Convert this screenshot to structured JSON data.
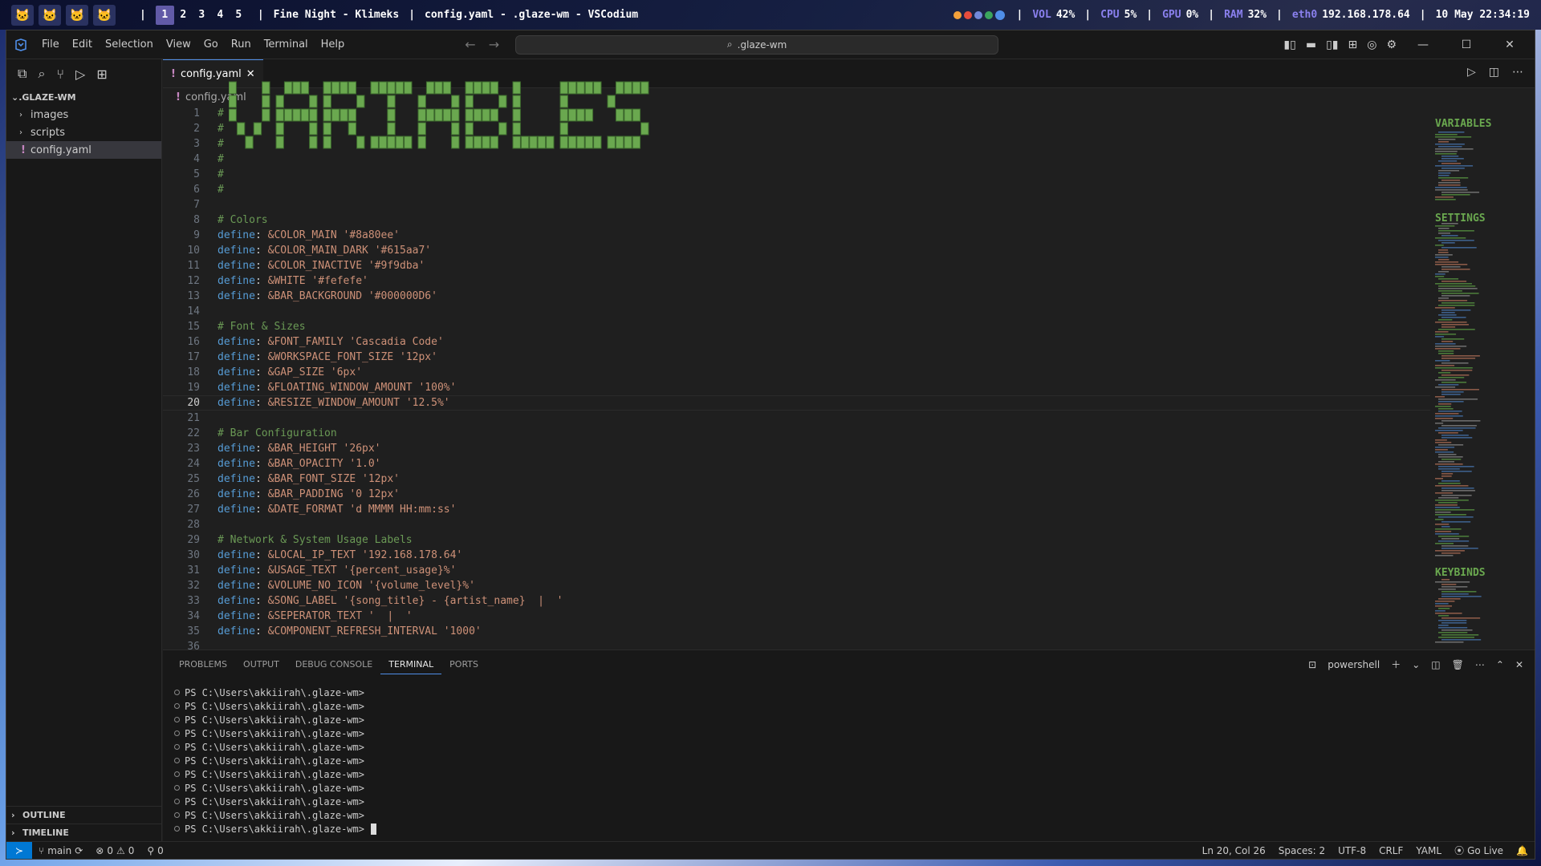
{
  "topbar": {
    "avatars": [
      "🐱",
      "🐱",
      "🐱",
      "🐱"
    ],
    "workspaces": [
      "1",
      "2",
      "3",
      "4",
      "5"
    ],
    "active_workspace": "1",
    "song": "Fine Night - Klimeks",
    "window_title": "config.yaml - .glaze-wm - VSCodium",
    "vol_label": "VOL",
    "vol_value": "42%",
    "cpu_label": "CPU",
    "cpu_value": "5%",
    "gpu_label": "GPU",
    "gpu_value": "0%",
    "ram_label": "RAM",
    "ram_value": "32%",
    "net_label": "eth0",
    "net_value": "192.168.178.64",
    "datetime": "10 May 22:34:19",
    "separator": "|"
  },
  "titlebar": {
    "menu": [
      "File",
      "Edit",
      "Selection",
      "View",
      "Go",
      "Run",
      "Terminal",
      "Help"
    ],
    "search_text": ".glaze-wm"
  },
  "sidebar": {
    "explorer_title": ".GLAZE-WM",
    "folders": [
      "images",
      "scripts"
    ],
    "file": "config.yaml",
    "outline": "OUTLINE",
    "timeline": "TIMELINE"
  },
  "editor": {
    "tab_label": "config.yaml",
    "breadcrumb": "config.yaml",
    "current_line": 20,
    "lines": [
      {
        "n": "1",
        "t": "# "
      },
      {
        "n": "2",
        "t": "# "
      },
      {
        "n": "3",
        "t": "# "
      },
      {
        "n": "4",
        "t": "# "
      },
      {
        "n": "5",
        "t": "# "
      },
      {
        "n": "6",
        "t": "# "
      },
      {
        "n": "7",
        "t": ""
      },
      {
        "n": "8",
        "t": "# Colors"
      },
      {
        "n": "9",
        "k": "define",
        "a": "&COLOR_MAIN",
        "s": "'#8a80ee'"
      },
      {
        "n": "10",
        "k": "define",
        "a": "&COLOR_MAIN_DARK",
        "s": "'#615aa7'"
      },
      {
        "n": "11",
        "k": "define",
        "a": "&COLOR_INACTIVE",
        "s": "'#9f9dba'"
      },
      {
        "n": "12",
        "k": "define",
        "a": "&WHITE",
        "s": "'#fefefe'"
      },
      {
        "n": "13",
        "k": "define",
        "a": "&BAR_BACKGROUND",
        "s": "'#000000D6'"
      },
      {
        "n": "14",
        "t": ""
      },
      {
        "n": "15",
        "t": "# Font & Sizes"
      },
      {
        "n": "16",
        "k": "define",
        "a": "&FONT_FAMILY",
        "s": "'Cascadia Code'"
      },
      {
        "n": "17",
        "k": "define",
        "a": "&WORKSPACE_FONT_SIZE",
        "s": "'12px'"
      },
      {
        "n": "18",
        "k": "define",
        "a": "&GAP_SIZE",
        "s": "'6px'"
      },
      {
        "n": "19",
        "k": "define",
        "a": "&FLOATING_WINDOW_AMOUNT",
        "s": "'100%'"
      },
      {
        "n": "20",
        "k": "define",
        "a": "&RESIZE_WINDOW_AMOUNT",
        "s": "'12.5%'"
      },
      {
        "n": "21",
        "t": ""
      },
      {
        "n": "22",
        "t": "# Bar Configuration"
      },
      {
        "n": "23",
        "k": "define",
        "a": "&BAR_HEIGHT",
        "s": "'26px'"
      },
      {
        "n": "24",
        "k": "define",
        "a": "&BAR_OPACITY",
        "s": "'1.0'"
      },
      {
        "n": "25",
        "k": "define",
        "a": "&BAR_FONT_SIZE",
        "s": "'12px'"
      },
      {
        "n": "26",
        "k": "define",
        "a": "&BAR_PADDING",
        "s": "'0 12px'"
      },
      {
        "n": "27",
        "k": "define",
        "a": "&DATE_FORMAT",
        "s": "'d MMMM HH:mm:ss'"
      },
      {
        "n": "28",
        "t": ""
      },
      {
        "n": "29",
        "t": "# Network & System Usage Labels"
      },
      {
        "n": "30",
        "k": "define",
        "a": "&LOCAL_IP_TEXT",
        "s": "'192.168.178.64'"
      },
      {
        "n": "31",
        "k": "define",
        "a": "&USAGE_TEXT",
        "s": "'{percent_usage}%'"
      },
      {
        "n": "32",
        "k": "define",
        "a": "&VOLUME_NO_ICON",
        "s": "'{volume_level}%'"
      },
      {
        "n": "33",
        "k": "define",
        "a": "&SONG_LABEL",
        "s": "'{song_title} - {artist_name}  |  '"
      },
      {
        "n": "34",
        "k": "define",
        "a": "&SEPERATOR_TEXT",
        "s": "'  |  '"
      },
      {
        "n": "35",
        "k": "define",
        "a": "&COMPONENT_REFRESH_INTERVAL",
        "s": "'1000'"
      },
      {
        "n": "36",
        "t": ""
      }
    ],
    "banner_text": "VARIABLES",
    "minimap_sections": [
      "VARIABLES",
      "SETTINGS",
      "KEYBINDS"
    ]
  },
  "panel": {
    "tabs": [
      "PROBLEMS",
      "OUTPUT",
      "DEBUG CONSOLE",
      "TERMINAL",
      "PORTS"
    ],
    "active_tab": "TERMINAL",
    "shell": "powershell",
    "prompt": "PS C:\\Users\\akkiirah\\.glaze-wm>",
    "prompt_count": 11
  },
  "statusbar": {
    "branch": "main",
    "errors": "0",
    "warnings": "0",
    "ports": "0",
    "position": "Ln 20, Col 26",
    "spaces": "Spaces: 2",
    "encoding": "UTF-8",
    "eol": "CRLF",
    "language": "YAML",
    "golive": "Go Live"
  },
  "colors": {
    "accent": "#8a80ee",
    "accent_dark": "#615aa7",
    "banner_green": "#6aa84f"
  }
}
